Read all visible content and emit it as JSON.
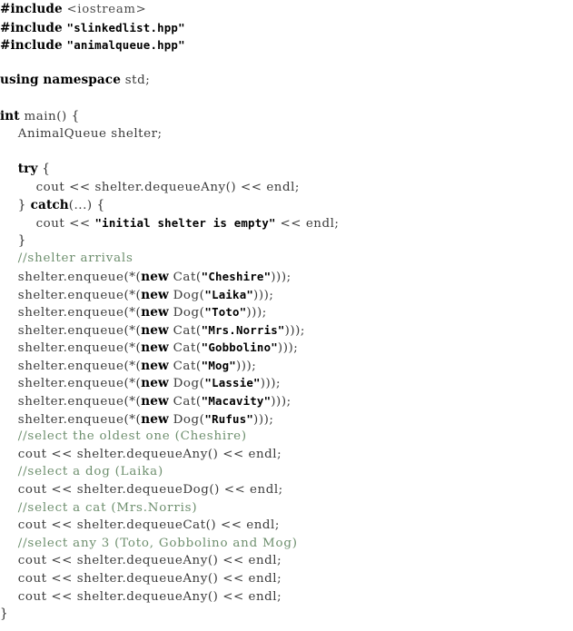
{
  "document": {
    "kind": "code-listing",
    "language": "C++",
    "background_color": "#ffffff",
    "colors": {
      "plain": "#3a3a3a",
      "keyword": "#000000",
      "string": "#000000",
      "comment": "#6e8f6e",
      "header": "#4a4a4a"
    }
  },
  "lines": [
    {
      "n": 1,
      "indent": 0,
      "tokens": [
        {
          "t": "key",
          "v": "#include"
        },
        {
          "t": "plain",
          "v": " "
        },
        {
          "t": "hdr",
          "v": "<iostream>"
        }
      ]
    },
    {
      "n": 2,
      "indent": 0,
      "tokens": [
        {
          "t": "key",
          "v": "#include"
        },
        {
          "t": "plain",
          "v": " "
        },
        {
          "t": "str",
          "v": "\"slinkedlist.hpp\""
        }
      ]
    },
    {
      "n": 3,
      "indent": 0,
      "tokens": [
        {
          "t": "key",
          "v": "#include"
        },
        {
          "t": "plain",
          "v": " "
        },
        {
          "t": "str",
          "v": "\"animalqueue.hpp\""
        }
      ]
    },
    {
      "n": 4,
      "indent": 0,
      "tokens": []
    },
    {
      "n": 5,
      "indent": 0,
      "tokens": [
        {
          "t": "key",
          "v": "using namespace"
        },
        {
          "t": "plain",
          "v": " std;"
        }
      ]
    },
    {
      "n": 6,
      "indent": 0,
      "tokens": []
    },
    {
      "n": 7,
      "indent": 0,
      "tokens": [
        {
          "t": "key",
          "v": "int"
        },
        {
          "t": "plain",
          "v": " main() "
        },
        {
          "t": "punc",
          "v": "{"
        }
      ]
    },
    {
      "n": 8,
      "indent": 2,
      "tokens": [
        {
          "t": "plain",
          "v": "AnimalQueue shelter;"
        }
      ]
    },
    {
      "n": 9,
      "indent": 0,
      "tokens": []
    },
    {
      "n": 10,
      "indent": 2,
      "tokens": [
        {
          "t": "key",
          "v": "try"
        },
        {
          "t": "plain",
          "v": " "
        },
        {
          "t": "punc",
          "v": "{"
        }
      ]
    },
    {
      "n": 11,
      "indent": 4,
      "tokens": [
        {
          "t": "plain",
          "v": "cout << shelter.dequeueAny() << endl;"
        }
      ]
    },
    {
      "n": 12,
      "indent": 2,
      "tokens": [
        {
          "t": "punc",
          "v": "}"
        },
        {
          "t": "plain",
          "v": " "
        },
        {
          "t": "key",
          "v": "catch"
        },
        {
          "t": "plain",
          "v": "(...) "
        },
        {
          "t": "punc",
          "v": "{"
        }
      ]
    },
    {
      "n": 13,
      "indent": 4,
      "tokens": [
        {
          "t": "plain",
          "v": "cout << "
        },
        {
          "t": "str",
          "v": "\"initial shelter is empty\""
        },
        {
          "t": "plain",
          "v": " << endl;"
        }
      ]
    },
    {
      "n": 14,
      "indent": 2,
      "tokens": [
        {
          "t": "punc",
          "v": "}"
        }
      ]
    },
    {
      "n": 15,
      "indent": 2,
      "tokens": [
        {
          "t": "cmt",
          "v": "//shelter arrivals"
        }
      ]
    },
    {
      "n": 16,
      "indent": 2,
      "tokens": [
        {
          "t": "plain",
          "v": "shelter.enqueue(*("
        },
        {
          "t": "key",
          "v": "new"
        },
        {
          "t": "plain",
          "v": " Cat("
        },
        {
          "t": "str",
          "v": "\"Cheshire\""
        },
        {
          "t": "plain",
          "v": ")));"
        }
      ]
    },
    {
      "n": 17,
      "indent": 2,
      "tokens": [
        {
          "t": "plain",
          "v": "shelter.enqueue(*("
        },
        {
          "t": "key",
          "v": "new"
        },
        {
          "t": "plain",
          "v": " Dog("
        },
        {
          "t": "str",
          "v": "\"Laika\""
        },
        {
          "t": "plain",
          "v": ")));"
        }
      ]
    },
    {
      "n": 18,
      "indent": 2,
      "tokens": [
        {
          "t": "plain",
          "v": "shelter.enqueue(*("
        },
        {
          "t": "key",
          "v": "new"
        },
        {
          "t": "plain",
          "v": " Dog("
        },
        {
          "t": "str",
          "v": "\"Toto\""
        },
        {
          "t": "plain",
          "v": ")));"
        }
      ]
    },
    {
      "n": 19,
      "indent": 2,
      "tokens": [
        {
          "t": "plain",
          "v": "shelter.enqueue(*("
        },
        {
          "t": "key",
          "v": "new"
        },
        {
          "t": "plain",
          "v": " Cat("
        },
        {
          "t": "str",
          "v": "\"Mrs.Norris\""
        },
        {
          "t": "plain",
          "v": ")));"
        }
      ]
    },
    {
      "n": 20,
      "indent": 2,
      "tokens": [
        {
          "t": "plain",
          "v": "shelter.enqueue(*("
        },
        {
          "t": "key",
          "v": "new"
        },
        {
          "t": "plain",
          "v": " Cat("
        },
        {
          "t": "str",
          "v": "\"Gobbolino\""
        },
        {
          "t": "plain",
          "v": ")));"
        }
      ]
    },
    {
      "n": 21,
      "indent": 2,
      "tokens": [
        {
          "t": "plain",
          "v": "shelter.enqueue(*("
        },
        {
          "t": "key",
          "v": "new"
        },
        {
          "t": "plain",
          "v": " Cat("
        },
        {
          "t": "str",
          "v": "\"Mog\""
        },
        {
          "t": "plain",
          "v": ")));"
        }
      ]
    },
    {
      "n": 22,
      "indent": 2,
      "tokens": [
        {
          "t": "plain",
          "v": "shelter.enqueue(*("
        },
        {
          "t": "key",
          "v": "new"
        },
        {
          "t": "plain",
          "v": " Dog("
        },
        {
          "t": "str",
          "v": "\"Lassie\""
        },
        {
          "t": "plain",
          "v": ")));"
        }
      ]
    },
    {
      "n": 23,
      "indent": 2,
      "tokens": [
        {
          "t": "plain",
          "v": "shelter.enqueue(*("
        },
        {
          "t": "key",
          "v": "new"
        },
        {
          "t": "plain",
          "v": " Cat("
        },
        {
          "t": "str",
          "v": "\"Macavity\""
        },
        {
          "t": "plain",
          "v": ")));"
        }
      ]
    },
    {
      "n": 24,
      "indent": 2,
      "tokens": [
        {
          "t": "plain",
          "v": "shelter.enqueue(*("
        },
        {
          "t": "key",
          "v": "new"
        },
        {
          "t": "plain",
          "v": " Dog("
        },
        {
          "t": "str",
          "v": "\"Rufus\""
        },
        {
          "t": "plain",
          "v": ")));"
        }
      ]
    },
    {
      "n": 25,
      "indent": 2,
      "tokens": [
        {
          "t": "cmt",
          "v": "//select the oldest one (Cheshire)"
        }
      ]
    },
    {
      "n": 26,
      "indent": 2,
      "tokens": [
        {
          "t": "plain",
          "v": "cout << shelter.dequeueAny() << endl;"
        }
      ]
    },
    {
      "n": 27,
      "indent": 2,
      "tokens": [
        {
          "t": "cmt",
          "v": "//select a dog (Laika)"
        }
      ]
    },
    {
      "n": 28,
      "indent": 2,
      "tokens": [
        {
          "t": "plain",
          "v": "cout << shelter.dequeueDog() << endl;"
        }
      ]
    },
    {
      "n": 29,
      "indent": 2,
      "tokens": [
        {
          "t": "cmt",
          "v": "//select a cat (Mrs.Norris)"
        }
      ]
    },
    {
      "n": 30,
      "indent": 2,
      "tokens": [
        {
          "t": "plain",
          "v": "cout << shelter.dequeueCat() << endl;"
        }
      ]
    },
    {
      "n": 31,
      "indent": 2,
      "tokens": [
        {
          "t": "cmt",
          "v": "//select any 3 (Toto, Gobbolino and Mog)"
        }
      ]
    },
    {
      "n": 32,
      "indent": 2,
      "tokens": [
        {
          "t": "plain",
          "v": "cout << shelter.dequeueAny() << endl;"
        }
      ]
    },
    {
      "n": 33,
      "indent": 2,
      "tokens": [
        {
          "t": "plain",
          "v": "cout << shelter.dequeueAny() << endl;"
        }
      ]
    },
    {
      "n": 34,
      "indent": 2,
      "tokens": [
        {
          "t": "plain",
          "v": "cout << shelter.dequeueAny() << endl;"
        }
      ]
    },
    {
      "n": 35,
      "indent": 0,
      "tokens": [
        {
          "t": "punc",
          "v": "}"
        }
      ]
    }
  ]
}
